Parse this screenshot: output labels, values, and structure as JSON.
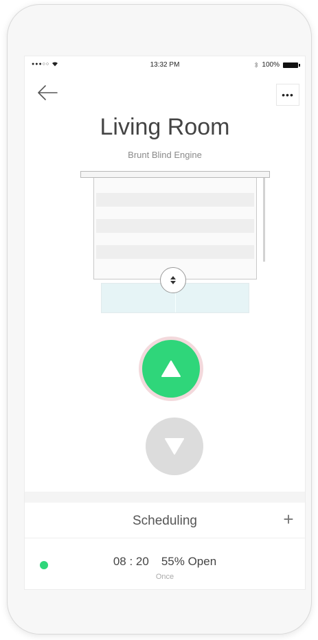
{
  "status_bar": {
    "signal": "●●●○○",
    "time": "13:32 PM",
    "battery_text": "100%"
  },
  "header": {
    "back_icon": "arrow-left-icon",
    "more_label": "•••"
  },
  "device": {
    "room": "Living Room",
    "name": "Brunt Blind Engine"
  },
  "controls": {
    "up_icon": "triangle-up-icon",
    "down_icon": "triangle-down-icon",
    "accent_color": "#2fd67a",
    "disabled_color": "#dcdcdc"
  },
  "scheduling": {
    "title": "Scheduling",
    "add_label": "+",
    "items": [
      {
        "time": "08 : 20",
        "status": "55% Open",
        "repeat": "Once",
        "active": true
      }
    ]
  }
}
